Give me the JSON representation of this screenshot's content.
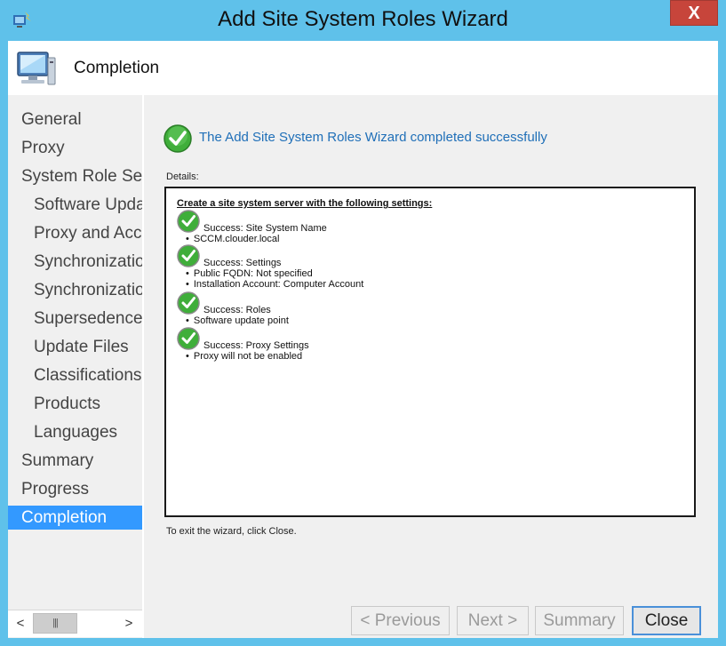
{
  "window": {
    "title": "Add Site System Roles Wizard",
    "close_glyph": "X"
  },
  "header": {
    "title": "Completion",
    "icon": "computer-monitor-icon"
  },
  "nav": {
    "items": [
      {
        "label": "General",
        "level": 1
      },
      {
        "label": "Proxy",
        "level": 1
      },
      {
        "label": "System Role Selection",
        "level": 1
      },
      {
        "label": "Software Update Point",
        "level": 2
      },
      {
        "label": "Proxy and Account Settings",
        "level": 2
      },
      {
        "label": "Synchronization Source",
        "level": 2
      },
      {
        "label": "Synchronization Schedule",
        "level": 2
      },
      {
        "label": "Supersedence Rules",
        "level": 2
      },
      {
        "label": "Update Files",
        "level": 2
      },
      {
        "label": "Classifications",
        "level": 2
      },
      {
        "label": "Products",
        "level": 2
      },
      {
        "label": "Languages",
        "level": 2
      },
      {
        "label": "Summary",
        "level": 1
      },
      {
        "label": "Progress",
        "level": 1
      },
      {
        "label": "Completion",
        "level": 1,
        "active": true
      }
    ],
    "scroll_left": "<",
    "scroll_right": ">",
    "scroll_thumb": "|||"
  },
  "main": {
    "success_message": "The Add Site System Roles Wizard completed successfully",
    "details_label": "Details:",
    "details_heading": "Create a site system server with the following settings:",
    "sections": [
      {
        "title": "Success: Site System Name",
        "bullets": [
          "SCCM.clouder.local"
        ]
      },
      {
        "title": "Success: Settings",
        "bullets": [
          "Public FQDN: Not specified",
          "Installation Account: Computer Account"
        ]
      },
      {
        "title": "Success: Roles",
        "bullets": [
          "Software update point"
        ]
      },
      {
        "title": "Success: Proxy Settings",
        "bullets": [
          "Proxy will not be enabled"
        ]
      }
    ],
    "exit_text": "To exit the wizard, click Close."
  },
  "buttons": {
    "previous": "< Previous",
    "next": "Next >",
    "summary": "Summary",
    "close": "Close"
  },
  "colors": {
    "frame": "#5fc1ea",
    "accent_selection": "#3399ff",
    "success_text": "#1f6fb8",
    "close_button": "#c7453b"
  }
}
